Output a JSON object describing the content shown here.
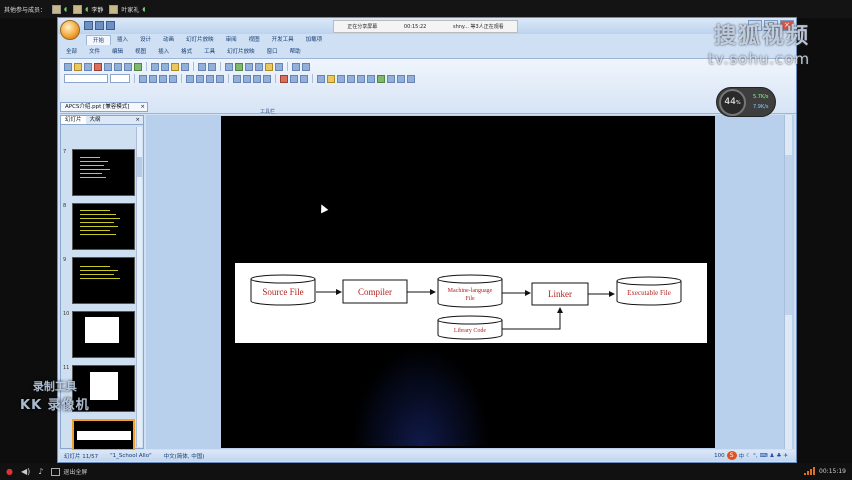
{
  "topbar": {
    "label": "其他参与成员：",
    "participants": [
      {
        "name": ""
      },
      {
        "name": "李静"
      },
      {
        "name": "叶家礼"
      }
    ]
  },
  "share_notice": {
    "status": "正在分享屏幕",
    "time": "00:15:22",
    "viewers": "shny... 等3人正在观看"
  },
  "ppt": {
    "ribbon_tabs": [
      "开始",
      "插入",
      "设计",
      "动画",
      "幻灯片放映",
      "审阅",
      "视图",
      "开发工具",
      "加载项"
    ],
    "active_ribbon_tab": "开始",
    "menu_items": [
      "全部",
      "文件",
      "编辑",
      "视图",
      "插入",
      "格式",
      "工具",
      "幻灯片放映",
      "窗口",
      "帮助"
    ],
    "ribbon_group_label": "工具栏",
    "doc_tab": "APCS介绍.ppt [兼容模式]",
    "outline_tabs": [
      "幻灯片",
      "大纲"
    ],
    "outline_close": "×",
    "slide_numbers": [
      "7",
      "8",
      "9",
      "10",
      "11"
    ],
    "window_controls": {
      "min": "–",
      "max": "□",
      "close": "×"
    }
  },
  "diagram": {
    "nodes": {
      "source": "Source File",
      "compiler": "Compiler",
      "machine1": "Machine-language",
      "machine2": "File",
      "linker": "Linker",
      "executable": "Executable File",
      "library": "Library Code"
    }
  },
  "statusbar": {
    "slide_info": "幻灯片 11/57",
    "theme": "\"1_School Allo\"",
    "language": "中文(简体, 中国)",
    "zoom": "100",
    "ime_label": "中"
  },
  "gauge": {
    "percent": "44",
    "unit": "%",
    "up": "5.7K/s",
    "down": "7.9K/s"
  },
  "watermark": {
    "cn": "搜狐视频",
    "en": "tv.sohu.com"
  },
  "kk": {
    "line1": "录制工具",
    "line2": "KK 录像机"
  },
  "bottombar": {
    "exit_label": "退出全屏",
    "time": "00:15:19"
  },
  "colors": {
    "accent_orange": "#f0a030",
    "diagram_text": "#b22222",
    "slide_bg": "#000000"
  }
}
